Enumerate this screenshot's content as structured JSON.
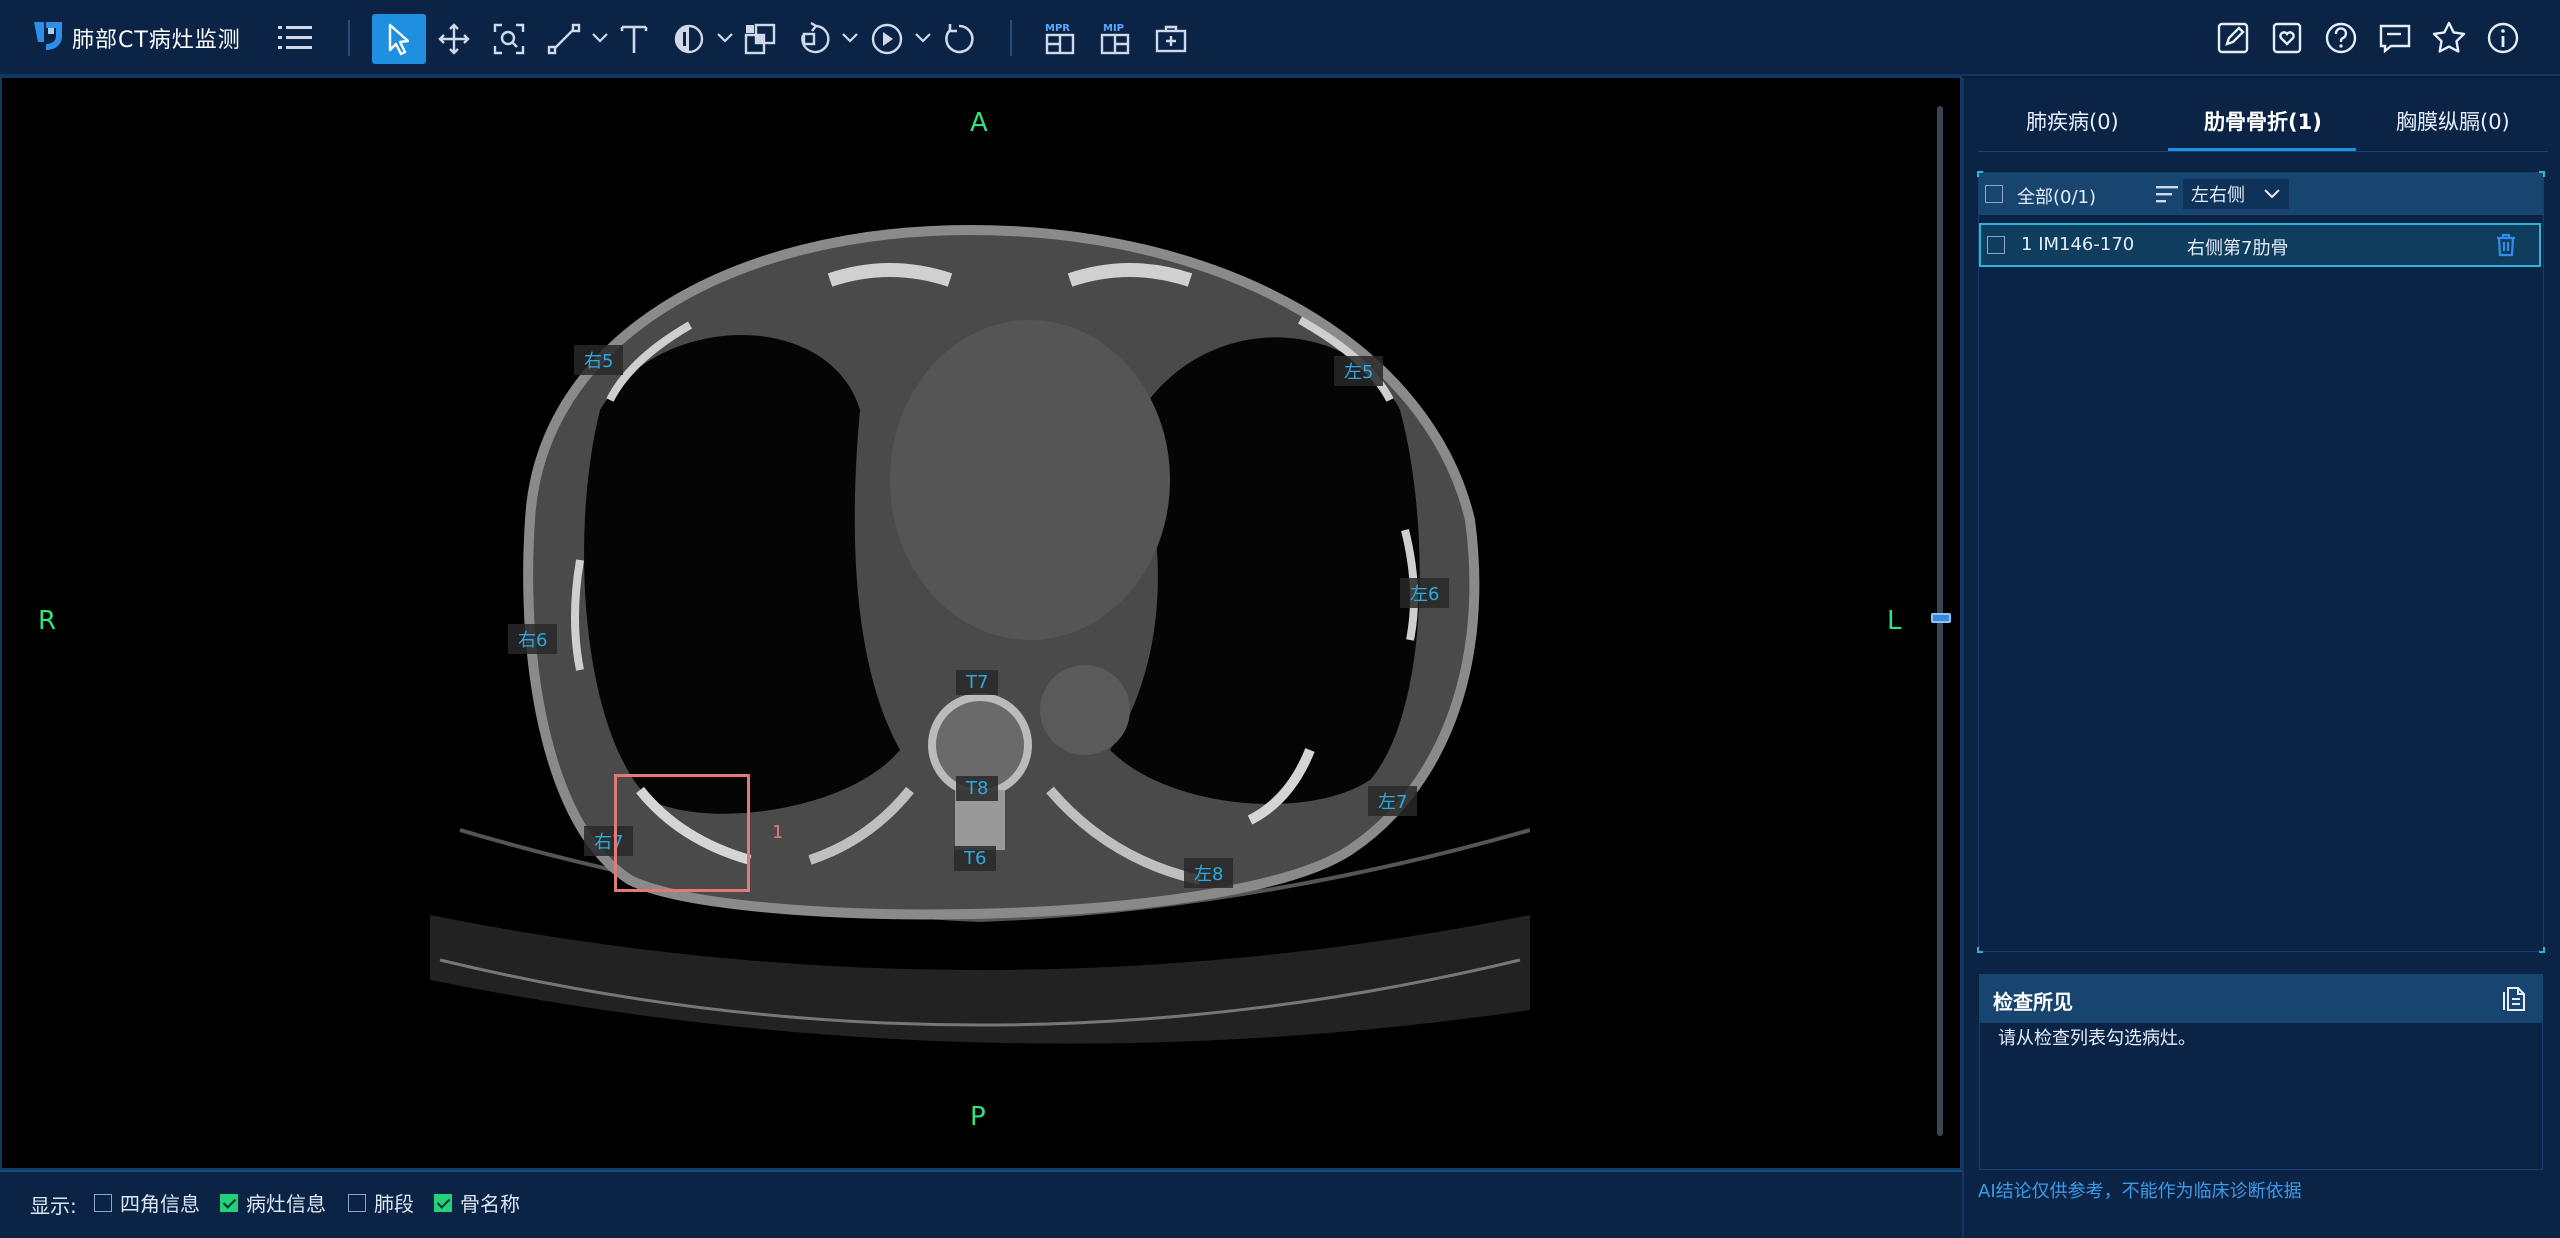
{
  "app": {
    "title": "肺部CT病灶监测"
  },
  "toolbar": {
    "tools": [
      "select-pointer",
      "pan",
      "zoom-region",
      "measure-line",
      "text-annotation",
      "window-level",
      "invert",
      "rotate",
      "cine-play",
      "reset"
    ],
    "mpr_label": "MPR",
    "mip_label": "MIP",
    "right_icons": [
      "edit-report",
      "bookmark",
      "help",
      "comment",
      "favorite",
      "info"
    ]
  },
  "viewer": {
    "orientation": {
      "top": "A",
      "bottom": "P",
      "left": "R",
      "right": "L"
    },
    "bone_labels": [
      "右5",
      "左5",
      "右6",
      "左6",
      "T7",
      "T8",
      "T6",
      "右7",
      "左7",
      "左8"
    ],
    "roi_index": "1"
  },
  "bottom": {
    "display_label": "显示:",
    "options": [
      {
        "label": "四角信息",
        "checked": false
      },
      {
        "label": "病灶信息",
        "checked": true
      },
      {
        "label": "肺段",
        "checked": false
      },
      {
        "label": "骨名称",
        "checked": true
      }
    ]
  },
  "panel": {
    "tabs": [
      {
        "label": "肺疾病(0)",
        "active": false
      },
      {
        "label": "肋骨骨折(1)",
        "active": true
      },
      {
        "label": "胸膜纵膈(0)",
        "active": false
      }
    ],
    "list": {
      "all_label": "全部(0/1)",
      "side_select": "左右侧",
      "rows": [
        {
          "index": "1",
          "image_range": "IM146-170",
          "bone": "右侧第7肋骨"
        }
      ]
    },
    "findings": {
      "title": "检查所见",
      "placeholder_text": "请从检查列表勾选病灶。"
    },
    "disclaimer": "AI结论仅供参考，不能作为临床诊断依据"
  },
  "colors": {
    "accent": "#1f8fe0",
    "orientation": "#35e07e",
    "bone_label": "#2fa8e0",
    "roi": "#e07a7a",
    "check": "#23d07e"
  }
}
